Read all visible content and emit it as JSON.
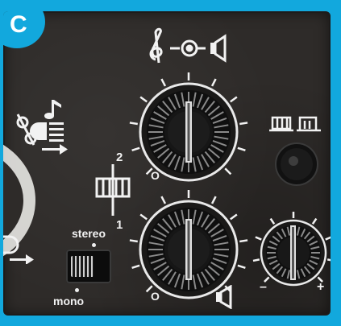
{
  "labels": {
    "fader_top": "2",
    "fader_bottom": "1",
    "switch_top": "stereo",
    "switch_bottom": "mono",
    "knob3_minus": "–",
    "knob3_plus": "+",
    "knob1_zero": "O",
    "knob2_zero": "O"
  },
  "colors": {
    "frame_blue": "#12a8dd",
    "panel": "#2e2b29",
    "print": "#f2f2f2"
  },
  "icons": [
    "treble-clef-icon",
    "disc-pickup-icon",
    "speaker-icon",
    "music-note-icon",
    "headlamp-icon",
    "tape-icon",
    "tape-alt-icon",
    "arrow-right-icon"
  ]
}
